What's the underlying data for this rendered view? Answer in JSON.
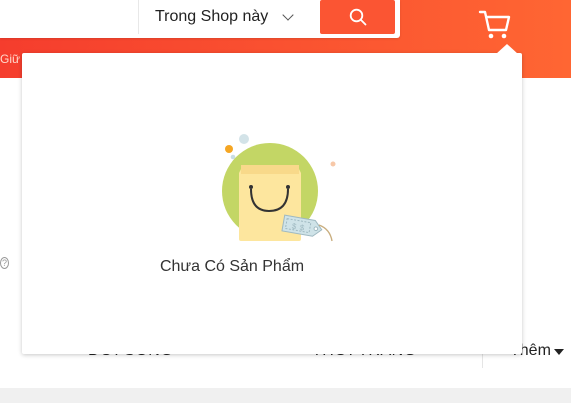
{
  "header": {
    "side_link": "Giữ",
    "search": {
      "scope_label": "Trong Shop này",
      "button_icon": "search-icon"
    },
    "cart_icon": "cart-icon",
    "accent_color": "#f53d2d"
  },
  "cart_popup": {
    "empty_text": "Chưa Có Sản Phẩm",
    "illustration": "empty-shopping-bag"
  },
  "nav": {
    "categories": [
      "ĐỜI SỐNG",
      "THỜI TRANG"
    ],
    "more_label": "Thêm"
  }
}
